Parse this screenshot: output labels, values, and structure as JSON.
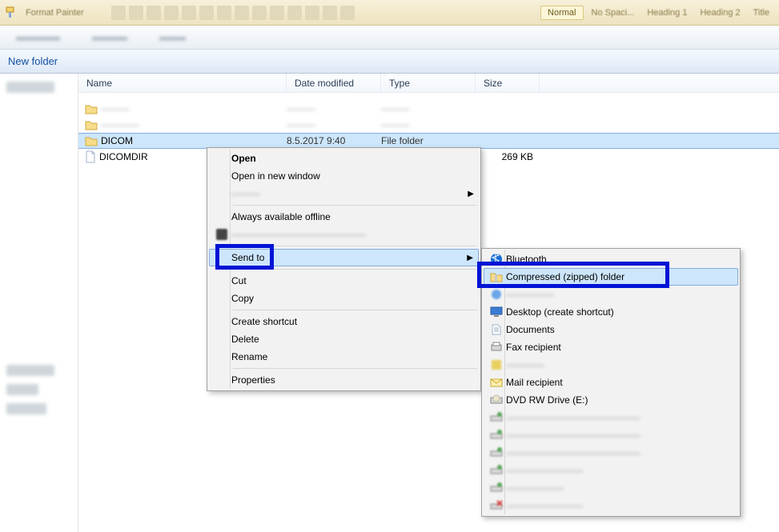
{
  "ribbon": {
    "formatPainter": "Format Painter",
    "btn": "Normal",
    "labels": [
      "No Spaci...",
      "Heading 1",
      "Heading 2",
      "Title"
    ]
  },
  "toolbar": {
    "newFolder": "New folder"
  },
  "columns": {
    "name": "Name",
    "date": "Date modified",
    "type": "Type",
    "size": "Size"
  },
  "rows": {
    "blur1": {
      "name": "———",
      "date": "———",
      "type": "———"
    },
    "blur2": {
      "name": "————",
      "date": "———",
      "type": "———"
    },
    "dicom": {
      "name": "DICOM",
      "date": "8.5.2017 9:40",
      "type": "File folder",
      "size": ""
    },
    "dicomdir": {
      "name": "DICOMDIR",
      "date": "",
      "type": "",
      "size": "269 KB"
    }
  },
  "ctx1": {
    "open": "Open",
    "openNew": "Open in new window",
    "redacted1": "———",
    "alwaysOffline": "Always available offline",
    "redacted2": "——————————————",
    "sendTo": "Send to",
    "cut": "Cut",
    "copy": "Copy",
    "createShortcut": "Create shortcut",
    "delete": "Delete",
    "rename": "Rename",
    "properties": "Properties"
  },
  "ctx2": {
    "bluetooth": "Bluetooth",
    "compressed": "Compressed (zipped) folder",
    "redactedA": "—————",
    "desktop": "Desktop (create shortcut)",
    "documents": "Documents",
    "fax": "Fax recipient",
    "redactedB": "————",
    "mail": "Mail recipient",
    "dvd": "DVD RW Drive (E:)",
    "net1": "——————————————",
    "net2": "——————————————",
    "net3": "——————————————",
    "net4": "————————",
    "net5": "——————",
    "net6": "————————"
  }
}
